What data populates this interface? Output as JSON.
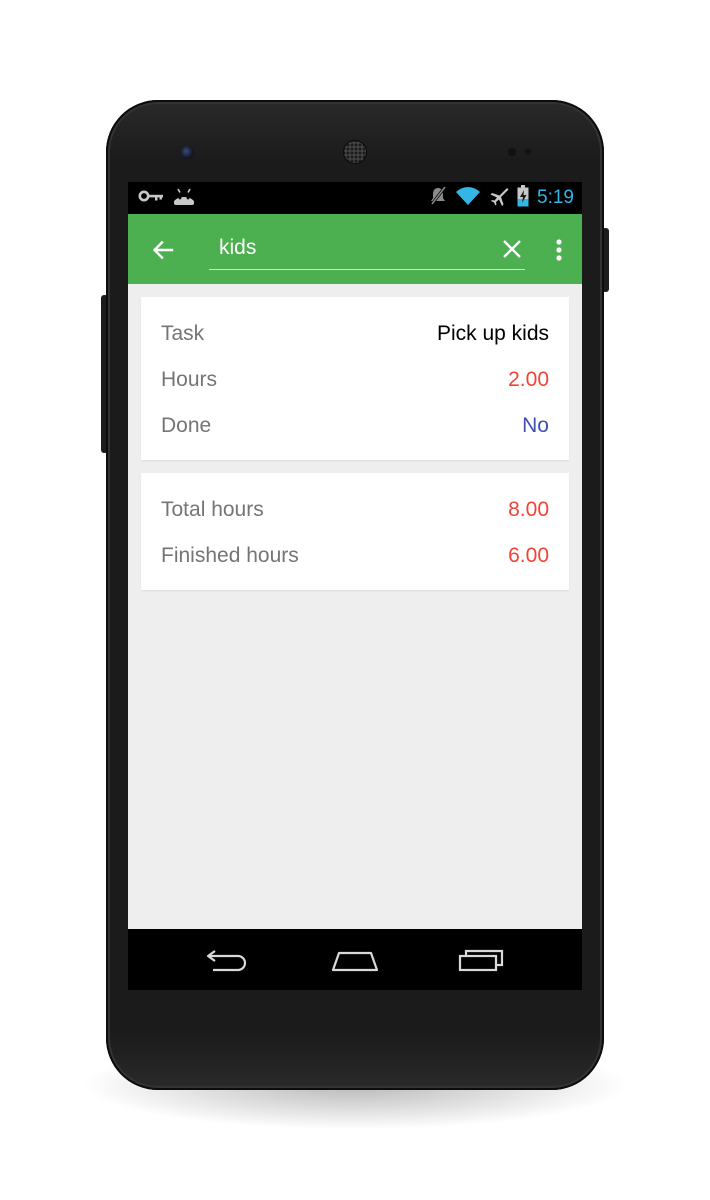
{
  "status_bar": {
    "time": "5:19",
    "icons": [
      "key-icon",
      "android-debug-icon",
      "mute-icon",
      "wifi-icon",
      "airplane-icon",
      "battery-charging-icon"
    ],
    "time_color": "#33b5e5"
  },
  "app_bar": {
    "color": "#4caf50",
    "search_value": "kids",
    "icons": [
      "back-arrow-icon",
      "clear-icon",
      "more-vert-icon"
    ]
  },
  "task_card": {
    "rows": [
      {
        "label": "Task",
        "value": "Pick up kids"
      },
      {
        "label": "Hours",
        "value": "2.00"
      },
      {
        "label": "Done",
        "value": "No"
      }
    ]
  },
  "totals_card": {
    "rows": [
      {
        "label": "Total hours",
        "value": "8.00"
      },
      {
        "label": "Finished hours",
        "value": "6.00"
      }
    ]
  },
  "nav_bar": {
    "icons": [
      "nav-back-icon",
      "nav-home-icon",
      "nav-recents-icon"
    ]
  },
  "colors": {
    "accent_red": "#f44336",
    "accent_blue": "#3f51b5",
    "background": "#eeeeee"
  }
}
